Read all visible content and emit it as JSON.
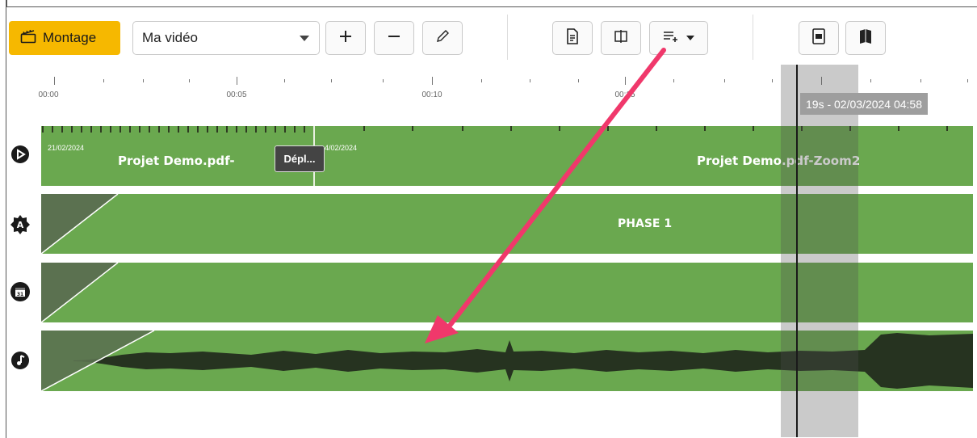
{
  "toolbar": {
    "montage_label": "Montage",
    "video_select_value": "Ma vidéo"
  },
  "ruler": {
    "labels": [
      "00:00",
      "00:05",
      "00:10",
      "00:15"
    ]
  },
  "playhead": {
    "label": "19s - 02/03/2024 04:58"
  },
  "tracks": {
    "video": {
      "clip1_date": "21/02/2024",
      "clip1_title": "Projet Demo.pdf-",
      "clip2_date": "4/02/2024",
      "clip2_title": "Projet Demo.pdf-Zoom2",
      "tooltip": "Dépl..."
    },
    "phase": {
      "title": "PHASE 1"
    }
  },
  "colors": {
    "accent": "#f6b800",
    "track_green": "#6aa84f",
    "arrow": "#f0386b"
  },
  "icons": [
    "clapperboard-icon",
    "plus-icon",
    "minus-icon",
    "pencil-icon",
    "document-icon",
    "split-icon",
    "list-add-icon",
    "export-icon",
    "book-icon",
    "play-circle-icon",
    "letter-a-badge-icon",
    "calendar-icon",
    "music-note-icon"
  ]
}
